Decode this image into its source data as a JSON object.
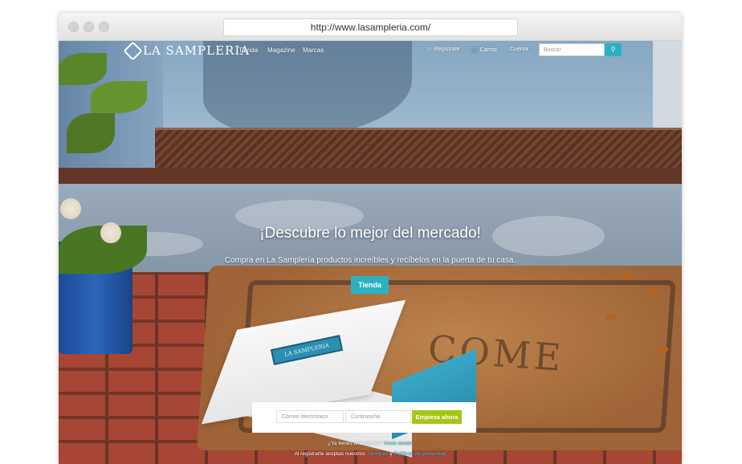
{
  "browser": {
    "url": "http://www.lasampleria.com/"
  },
  "nav": {
    "logo": "LA SAMPLERIA",
    "links": [
      "Tienda",
      "Magazine",
      "Marcas"
    ],
    "register": "Regístrate",
    "cart": "Carrito",
    "account": "Cuenta",
    "search_placeholder": "Buscar"
  },
  "hero": {
    "title": "¡Descubre lo mejor del mercado!",
    "subtitle": "Compra en La Samplería productos increíbles y recíbelos en la puerta de tu casa.",
    "cta": "Tienda"
  },
  "box": {
    "label": "LA SAMPLERIA"
  },
  "signup": {
    "email_placeholder": "Correo electrónico",
    "password_placeholder": "Contraseña",
    "submit": "Empieza ahora",
    "have_account": "¿Ya tienes una cuenta?",
    "login_link": "Inicia sesión",
    "terms_prefix": "Al registrarte aceptas nuestros",
    "terms_link": "Términos",
    "terms_and": "y",
    "privacy_link": "Políticas de privacidad"
  },
  "colors": {
    "accent": "#2bb2c0",
    "cta_green": "#a6c616"
  },
  "mat_text": "COME"
}
